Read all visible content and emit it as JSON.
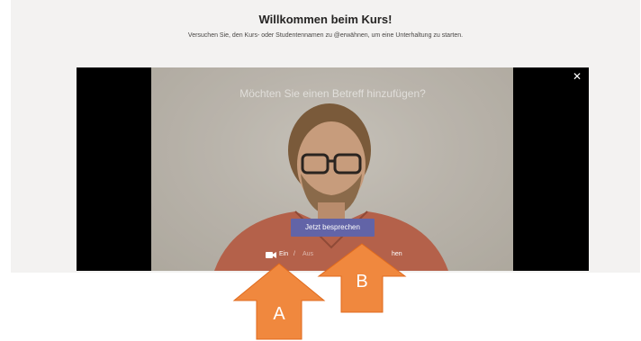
{
  "header": {
    "title": "Willkommen beim Kurs!",
    "subtitle": "Versuchen Sie, den Kurs- oder Studentennamen zu @erwähnen, um eine Unterhaltung zu starten."
  },
  "preview": {
    "subject_placeholder": "Möchten Sie einen Betreff hinzufügen?",
    "close_icon": "close-icon",
    "join_button_label": "Jetzt besprechen",
    "camera_on_label": "Ein",
    "camera_separator": "/",
    "camera_off_label": "Aus",
    "background_label_fragment": "hen"
  },
  "annotations": {
    "arrow_a_label": "A",
    "arrow_b_label": "B",
    "arrow_color": "#f0883e"
  },
  "colors": {
    "page_bg": "#f3f2f1",
    "accent": "#6264a7",
    "preview_bg": "#000000"
  }
}
